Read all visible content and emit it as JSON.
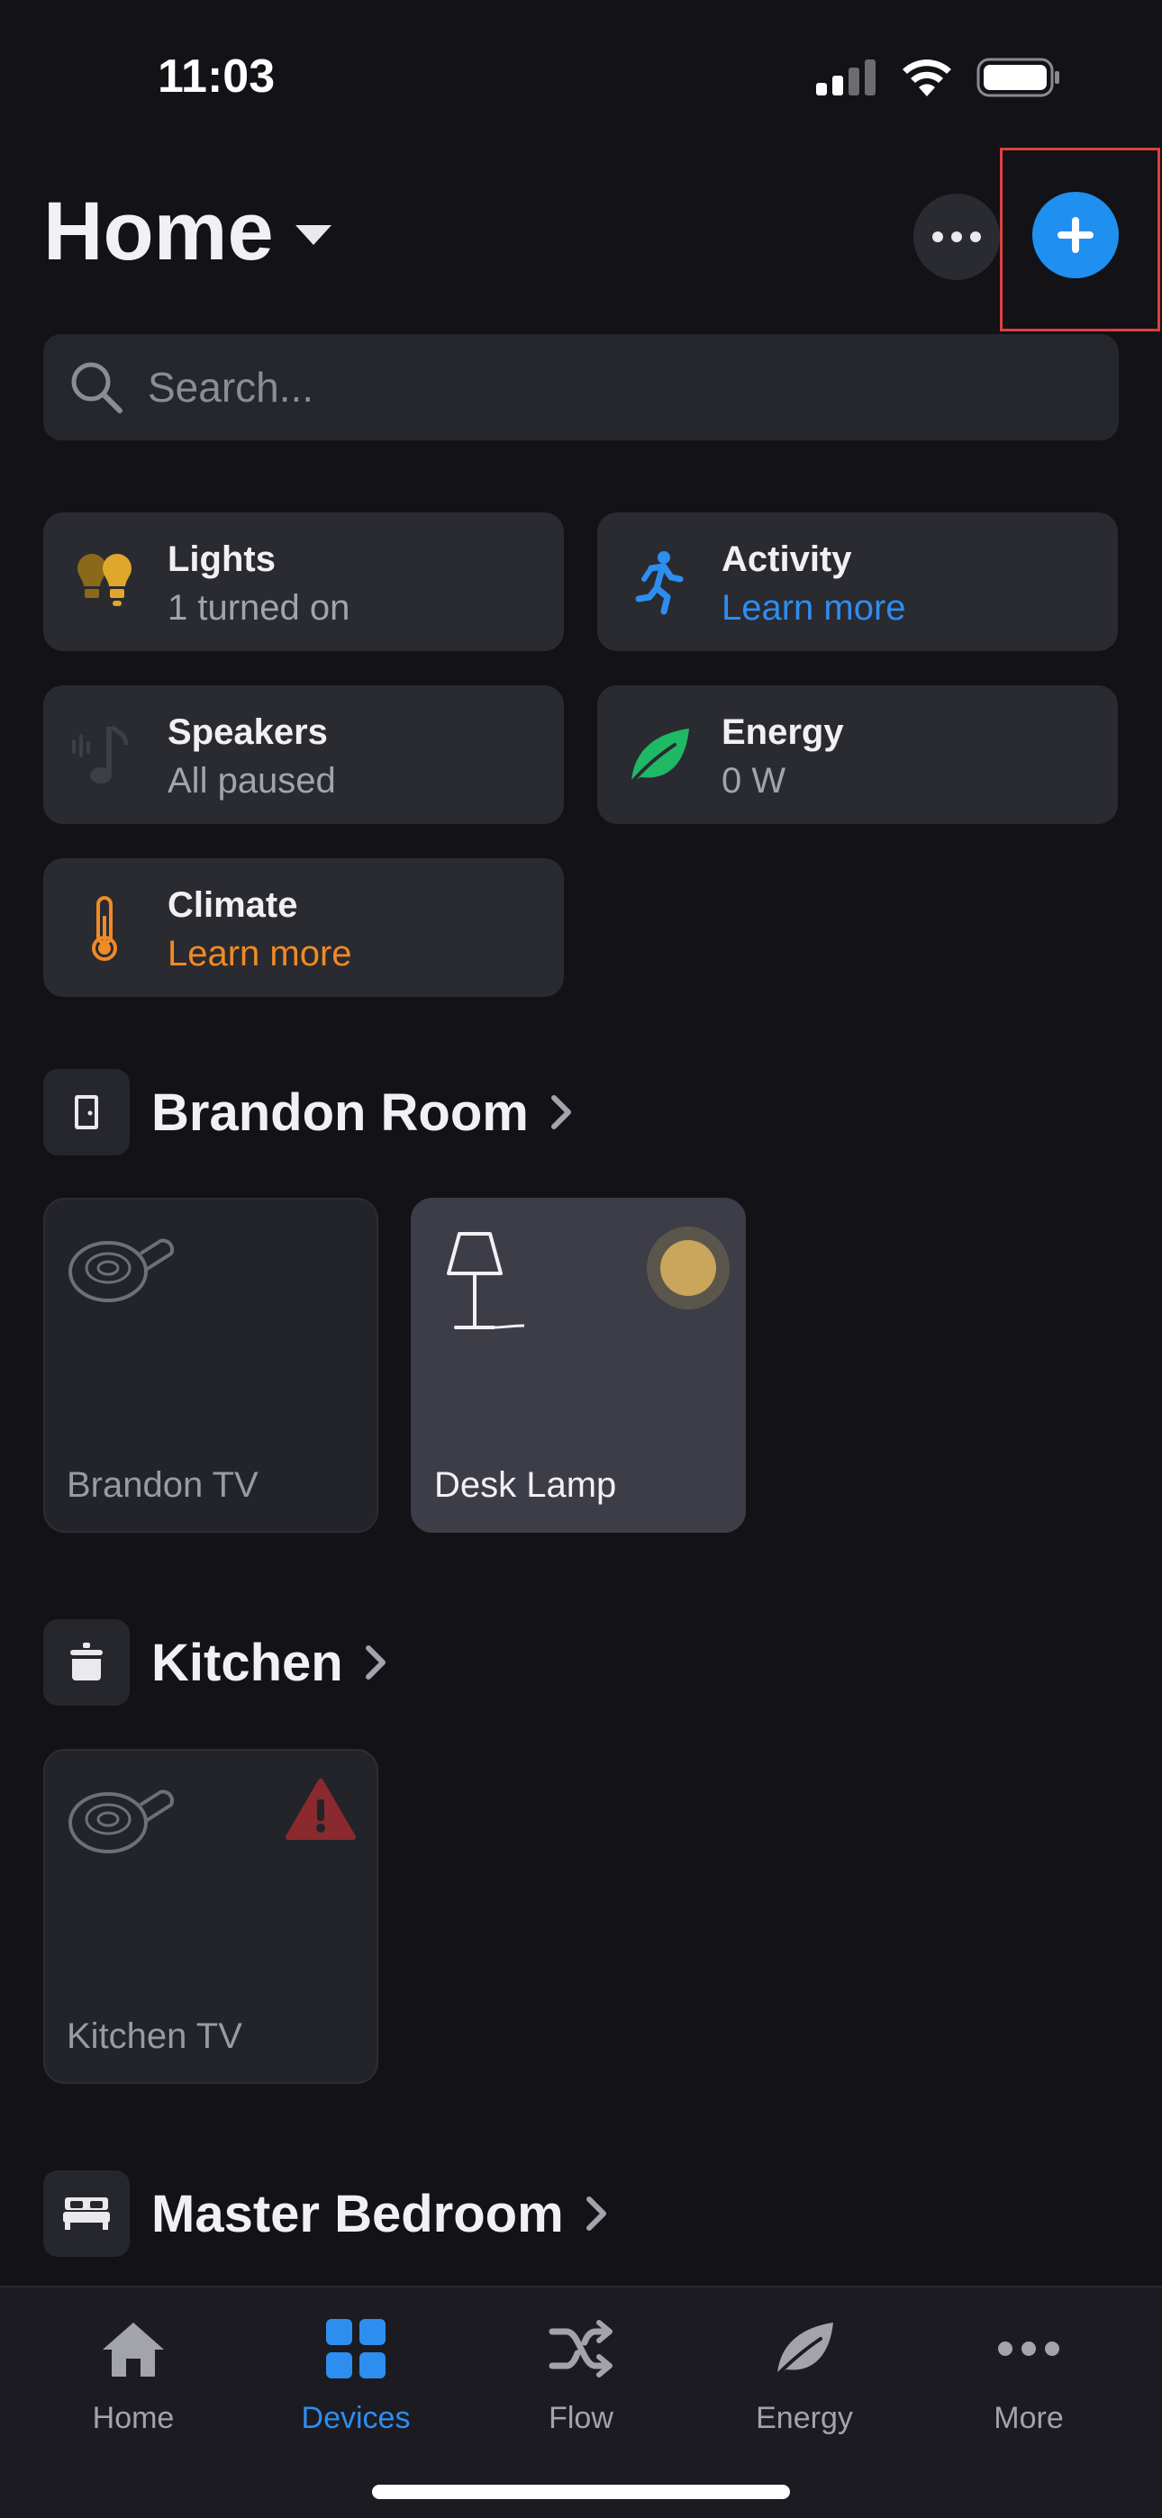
{
  "status_bar": {
    "time": "11:03"
  },
  "header": {
    "title": "Home"
  },
  "search": {
    "placeholder": "Search..."
  },
  "summary_cards": {
    "lights": {
      "title": "Lights",
      "subtitle": "1 turned on"
    },
    "activity": {
      "title": "Activity",
      "subtitle": "Learn more"
    },
    "speakers": {
      "title": "Speakers",
      "subtitle": "All paused"
    },
    "energy": {
      "title": "Energy",
      "subtitle": "0 W"
    },
    "climate": {
      "title": "Climate",
      "subtitle": "Learn more"
    }
  },
  "rooms": [
    {
      "name": "Brandon Room",
      "devices": [
        {
          "label": "Brandon TV"
        },
        {
          "label": "Desk Lamp"
        }
      ]
    },
    {
      "name": "Kitchen",
      "devices": [
        {
          "label": "Kitchen TV"
        }
      ]
    },
    {
      "name": "Master Bedroom",
      "devices": []
    }
  ],
  "tabs": [
    {
      "label": "Home"
    },
    {
      "label": "Devices"
    },
    {
      "label": "Flow"
    },
    {
      "label": "Energy"
    },
    {
      "label": "More"
    }
  ],
  "colors": {
    "background": "#121217",
    "card": "#2a2a31",
    "accent_blue": "#2d8ef0",
    "accent_orange": "#f08a24",
    "lamp_on": "#c9a65b",
    "warning_red": "#8a2a2e",
    "energy_green": "#1fb865",
    "lights_amber": "#c8961e"
  }
}
